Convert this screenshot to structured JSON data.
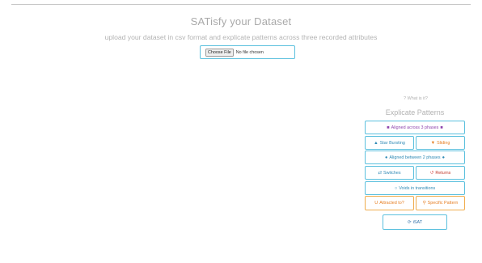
{
  "header": {
    "title": "SATisfy your Dataset",
    "subtitle": "upload your dataset in csv format and explicate patterns across three recorded attributes"
  },
  "upload": {
    "choose_label": "Choose File",
    "status": "No file chosen"
  },
  "panel": {
    "what_is_it": "What is it?",
    "title": "Explicate Patterns",
    "buttons": {
      "aligned_three": "Aligned across 3 phases",
      "star_bursting": "Star Bursting",
      "sliding": "Sliding",
      "aligned_two": "Aligned between 2 phases",
      "switches": "Switches",
      "returns": "Returns",
      "voids": "Voids in transitions",
      "attracted": "Attracted to?",
      "specific": "Specific Pattern",
      "isat": "iSAT"
    }
  },
  "colors": {
    "blue_border": "#5bc0de",
    "orange_border": "#f0ad4e",
    "purple_text": "#8e44ad"
  }
}
